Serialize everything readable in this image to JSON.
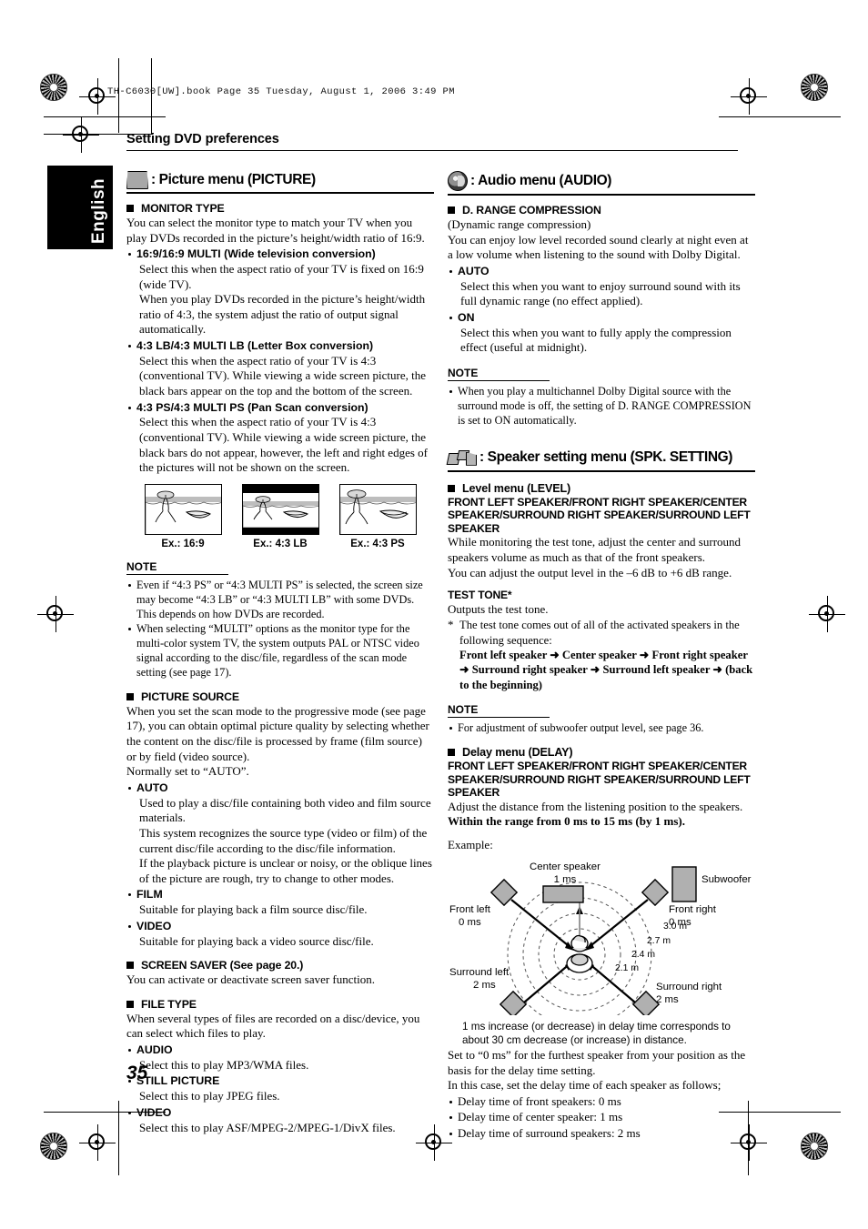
{
  "meta": {
    "file_stamp": "TH-C6030[UW].book  Page 35  Tuesday, August 1, 2006  3:49 PM",
    "language_tab": "English",
    "page_number": "35",
    "section_title": "Setting DVD preferences"
  },
  "picture_menu": {
    "icon": "tv-monitor-icon",
    "title": ": Picture menu (PICTURE)",
    "monitor_type": {
      "heading": "MONITOR TYPE",
      "intro": "You can select the monitor type to match your TV when you play DVDs recorded in the picture’s height/width ratio of 16:9.",
      "options": [
        {
          "label": "16:9/16:9 MULTI (Wide television conversion)",
          "desc": "Select this when the aspect ratio of your TV is fixed on 16:9 (wide TV).",
          "desc2": "When you play DVDs recorded in the picture’s height/width ratio of 4:3, the system adjust the ratio of output signal automatically."
        },
        {
          "label": "4:3 LB/4:3 MULTI LB (Letter Box conversion)",
          "desc": "Select this when the aspect ratio of your TV is 4:3 (conventional TV). While viewing a wide screen picture, the black bars appear on the top and the bottom of the screen."
        },
        {
          "label": "4:3 PS/4:3 MULTI PS (Pan Scan conversion)",
          "desc": "Select this when the aspect ratio of your TV is 4:3 (conventional TV). While viewing a wide screen picture, the black bars do not appear, however, the left and right edges of the pictures will not be shown on the screen."
        }
      ],
      "examples": [
        {
          "caption": "Ex.: 16:9",
          "style": "wide"
        },
        {
          "caption": "Ex.: 4:3 LB",
          "style": "letterbox"
        },
        {
          "caption": "Ex.: 4:3 PS",
          "style": "panscan"
        }
      ],
      "note": {
        "heading": "NOTE",
        "items": [
          "Even if “4:3 PS” or “4:3 MULTI PS” is selected, the screen size may become “4:3 LB” or “4:3 MULTI LB” with some DVDs. This depends on how DVDs are recorded.",
          "When selecting “MULTI” options as the monitor type for the multi-color system TV, the system outputs PAL or NTSC video signal according to the disc/file, regardless of the scan mode setting (see page 17)."
        ]
      }
    },
    "picture_source": {
      "heading": "PICTURE SOURCE",
      "intro": "When you set the scan mode to the progressive mode (see page 17), you can obtain optimal picture quality by selecting whether the content on the disc/file is processed by frame (film source) or by field (video source).",
      "intro2": "Normally set to “AUTO”.",
      "options": [
        {
          "label": "AUTO",
          "desc": "Used to play a disc/file containing both video and film source materials.",
          "desc2": "This system recognizes the source type (video or film) of the current disc/file according to the disc/file information.",
          "desc3": "If the playback picture is unclear or noisy, or the oblique lines of the picture are rough, try to change to other modes."
        },
        {
          "label": "FILM",
          "desc": "Suitable for playing back a film source disc/file."
        },
        {
          "label": "VIDEO",
          "desc": "Suitable for playing back a video source disc/file."
        }
      ]
    },
    "screen_saver": {
      "heading": "SCREEN SAVER (See page 20.)",
      "intro": "You can activate or deactivate screen saver function."
    },
    "file_type": {
      "heading": "FILE TYPE",
      "intro": "When several types of files are recorded on a disc/device, you can select which files to play.",
      "options": [
        {
          "label": "AUDIO",
          "desc": "Select this to play MP3/WMA files."
        },
        {
          "label": "STILL PICTURE",
          "desc": "Select this to play JPEG files."
        },
        {
          "label": "VIDEO",
          "desc": "Select this to play ASF/MPEG-2/MPEG-1/DivX files."
        }
      ]
    }
  },
  "audio_menu": {
    "icon": "speaker-disc-icon",
    "title": ": Audio menu (AUDIO)",
    "d_range": {
      "heading": "D. RANGE COMPRESSION",
      "subtitle": "(Dynamic range compression)",
      "intro": "You can enjoy low level recorded sound clearly at night even at a low volume when listening to the sound with Dolby Digital.",
      "options": [
        {
          "label": "AUTO",
          "desc": "Select this when you want to enjoy surround sound with its full dynamic range (no effect applied)."
        },
        {
          "label": "ON",
          "desc": "Select this when you want to fully apply the compression effect (useful at midnight)."
        }
      ],
      "note": {
        "heading": "NOTE",
        "items": [
          "When you play a multichannel Dolby Digital source with the surround mode is off, the setting of D. RANGE COMPRESSION is set to ON automatically."
        ]
      }
    }
  },
  "speaker_menu": {
    "icon": "speakers-icon",
    "title": ": Speaker setting menu (SPK. SETTING)",
    "level_menu": {
      "heading": "Level menu (LEVEL)",
      "channels": "FRONT LEFT SPEAKER/FRONT RIGHT SPEAKER/CENTER SPEAKER/SURROUND RIGHT SPEAKER/SURROUND LEFT SPEAKER",
      "intro": "While monitoring the test tone, adjust the center and surround speakers volume as much as that of the front speakers.",
      "intro2": "You can adjust the output level in the –6 dB to +6 dB range.",
      "test_tone_heading": "TEST TONE*",
      "test_tone_desc": "Outputs the test tone.",
      "footnote_marker": "*",
      "footnote": "The test tone comes out of all of the activated speakers in the following sequence:",
      "sequence": "Front left speaker ➜ Center speaker ➜ Front right speaker ➜ Surround right speaker ➜ Surround left speaker ➜ (back to the beginning)",
      "note": {
        "heading": "NOTE",
        "items": [
          "For adjustment of subwoofer output level, see page 36."
        ]
      }
    },
    "delay_menu": {
      "heading": "Delay menu (DELAY)",
      "channels": "FRONT LEFT SPEAKER/FRONT RIGHT SPEAKER/CENTER SPEAKER/SURROUND RIGHT SPEAKER/SURROUND LEFT SPEAKER",
      "intro": "Adjust the distance from the listening position to the speakers.",
      "range": "Within the range from 0 ms to 15 ms (by 1 ms).",
      "example_label": "Example:",
      "diagram": {
        "speakers": [
          {
            "name": "center",
            "label": "Center speaker",
            "delay": "1 ms"
          },
          {
            "name": "subwoofer",
            "label": "Subwoofer",
            "delay": ""
          },
          {
            "name": "front-left",
            "label": "Front left",
            "delay": "0 ms"
          },
          {
            "name": "front-right",
            "label": "Front right",
            "delay": "0 ms"
          },
          {
            "name": "surround-left",
            "label": "Surround left",
            "delay": "2 ms"
          },
          {
            "name": "surround-right",
            "label": "Surround right",
            "delay": "2 ms"
          }
        ],
        "distance_rings": [
          "2.1 m",
          "2.4 m",
          "2.7 m",
          "3.0 m"
        ]
      },
      "diagram_note": "1 ms increase (or decrease) in delay time corresponds to about 30 cm decrease (or increase) in distance.",
      "after1": "Set to “0 ms” for the furthest speaker from your position as the basis for the delay time setting.",
      "after2": "In this case, set the delay time of each speaker as follows;",
      "delay_list": [
        "Delay time of front speakers: 0 ms",
        "Delay time of center speaker: 1 ms",
        "Delay time of surround speakers: 2 ms"
      ]
    }
  },
  "colors": {
    "speaker_fill": "#b0b0b0",
    "tab_bg": "#000000"
  }
}
